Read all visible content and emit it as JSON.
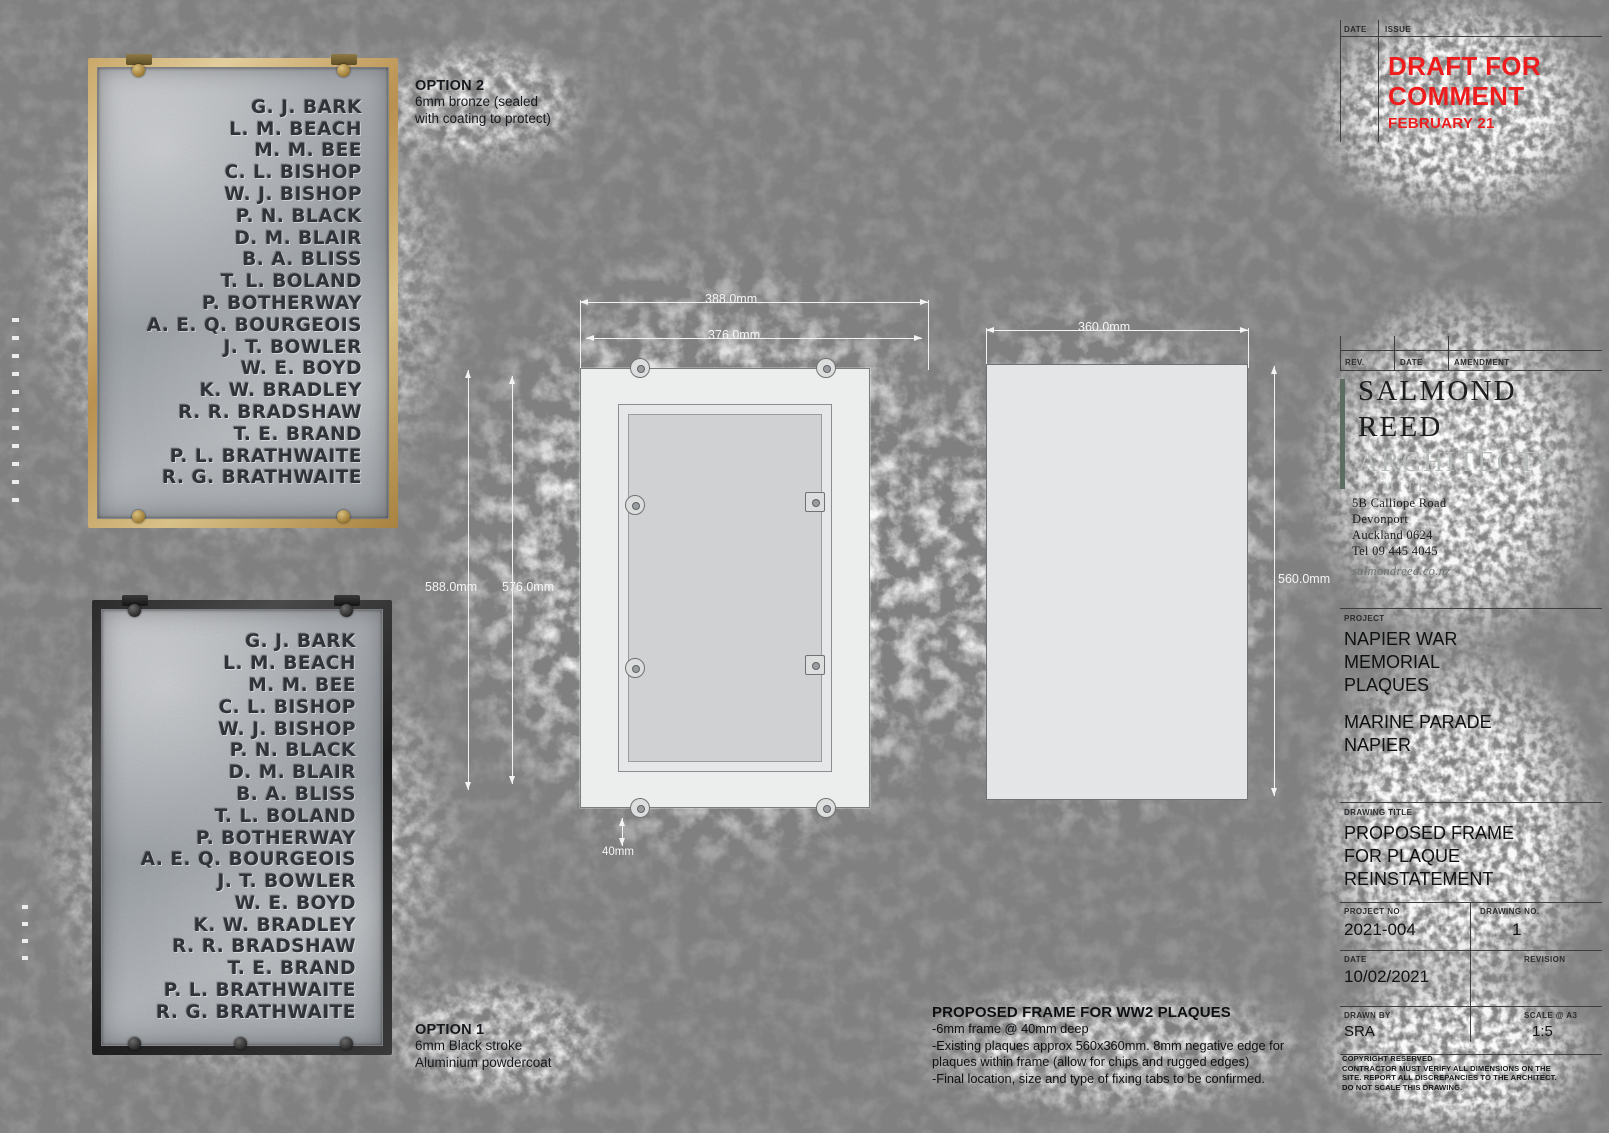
{
  "sheet": {
    "background_color": "#808080",
    "paper_color": "#ffffff"
  },
  "plaques": [
    {
      "id": "plaque-option-2",
      "frame_style": "brass",
      "names": [
        "G. J. BARK",
        "L. M. BEACH",
        "M. M. BEE",
        "C. L. BISHOP",
        "W. J. BISHOP",
        "P. N. BLACK",
        "D. M. BLAIR",
        "B. A. BLISS",
        "T. L. BOLAND",
        "P. BOTHERWAY",
        "A. E. Q. BOURGEOIS",
        "J. T. BOWLER",
        "W. E. BOYD",
        "K. W. BRADLEY",
        "R. R. BRADSHAW",
        "T. E. BRAND",
        "P. L. BRATHWAITE",
        "R. G. BRATHWAITE"
      ]
    },
    {
      "id": "plaque-option-1",
      "frame_style": "black",
      "names": [
        "G. J. BARK",
        "L. M. BEACH",
        "M. M. BEE",
        "C. L. BISHOP",
        "W. J. BISHOP",
        "P. N. BLACK",
        "D. M. BLAIR",
        "B. A. BLISS",
        "T. L. BOLAND",
        "P. BOTHERWAY",
        "A. E. Q. BOURGEOIS",
        "J. T. BOWLER",
        "W. E. BOYD",
        "K. W. BRADLEY",
        "R. R. BRADSHAW",
        "T. E. BRAND",
        "P. L. BRATHWAITE",
        "R. G. BRATHWAITE"
      ]
    }
  ],
  "option_2": {
    "title": "OPTION 2",
    "line_1": "6mm bronze (sealed",
    "line_2": "with coating to protect)"
  },
  "option_1": {
    "title": "OPTION 1",
    "line_1": "6mm Black stroke",
    "line_2": "Aluminium powdercoat"
  },
  "dimensions": {
    "frame_width_outer": "388.0mm",
    "frame_width_inner": "376.0mm",
    "frame_height_outer": "588.0mm",
    "frame_height_inner": "576.0mm",
    "plaque_width": "360.0mm",
    "plaque_height": "560.0mm",
    "frame_depth": "40mm"
  },
  "notes": {
    "title": "PROPOSED FRAME FOR WW2 PLAQUES",
    "lines": [
      "-6mm frame @ 40mm deep",
      "-Existing plaques approx 560x360mm. 8mm negative edge for",
      "plaques within frame (allow for chips and rugged edges)",
      "-Final location, size and type of fixing tabs to be confirmed."
    ]
  },
  "titleblock": {
    "issue_header_date": "DATE",
    "issue_header_issue": "ISSUE",
    "draft_line_1": "DRAFT FOR",
    "draft_line_2": "COMMENT",
    "draft_line_3": "FEBRUARY 21",
    "draft_color": "#ee1c1c",
    "amendment_header_rev": "REV.",
    "amendment_header_date": "DATE",
    "amendment_header_amendment": "AMENDMENT",
    "logo": {
      "line_1": "SALMOND",
      "line_2": "REED",
      "line_3": "ARCHITECTS",
      "line_4": "LIMITED",
      "bar_color": "#5d6d62"
    },
    "address": {
      "line_1": "5B Calliope Road",
      "line_2": "Devonport",
      "line_3": "Auckland 0624",
      "line_4": "Tel 09 445 4045",
      "website": "salmondreed.co.nz"
    },
    "project_header": "PROJECT",
    "project_name": "NAPIER WAR\nMEMORIAL\nPLAQUES",
    "project_location": "MARINE PARADE\nNAPIER",
    "drawing_title_header": "DRAWING TITLE",
    "drawing_title": "PROPOSED FRAME\nFOR PLAQUE\nREINSTATEMENT",
    "project_no_header": "PROJECT NO",
    "project_no": "2021-004",
    "drawing_no_header": "DRAWING NO.",
    "drawing_no": "1",
    "date_header": "DATE",
    "date": "10/02/2021",
    "revision_header": "REVISION",
    "revision": "",
    "drawn_by_header": "DRAWN BY",
    "drawn_by": "SRA",
    "scale_header": "SCALE @ A3",
    "scale": "1:5",
    "copyright": [
      "COPYRIGHT RESERVED",
      "CONTRACTOR MUST VERIFY ALL DIMENSIONS ON THE",
      "SITE. REPORT ALL DISCREPANCIES TO THE ARCHITECT.",
      "DO NOT SCALE THIS DRAWING."
    ]
  }
}
